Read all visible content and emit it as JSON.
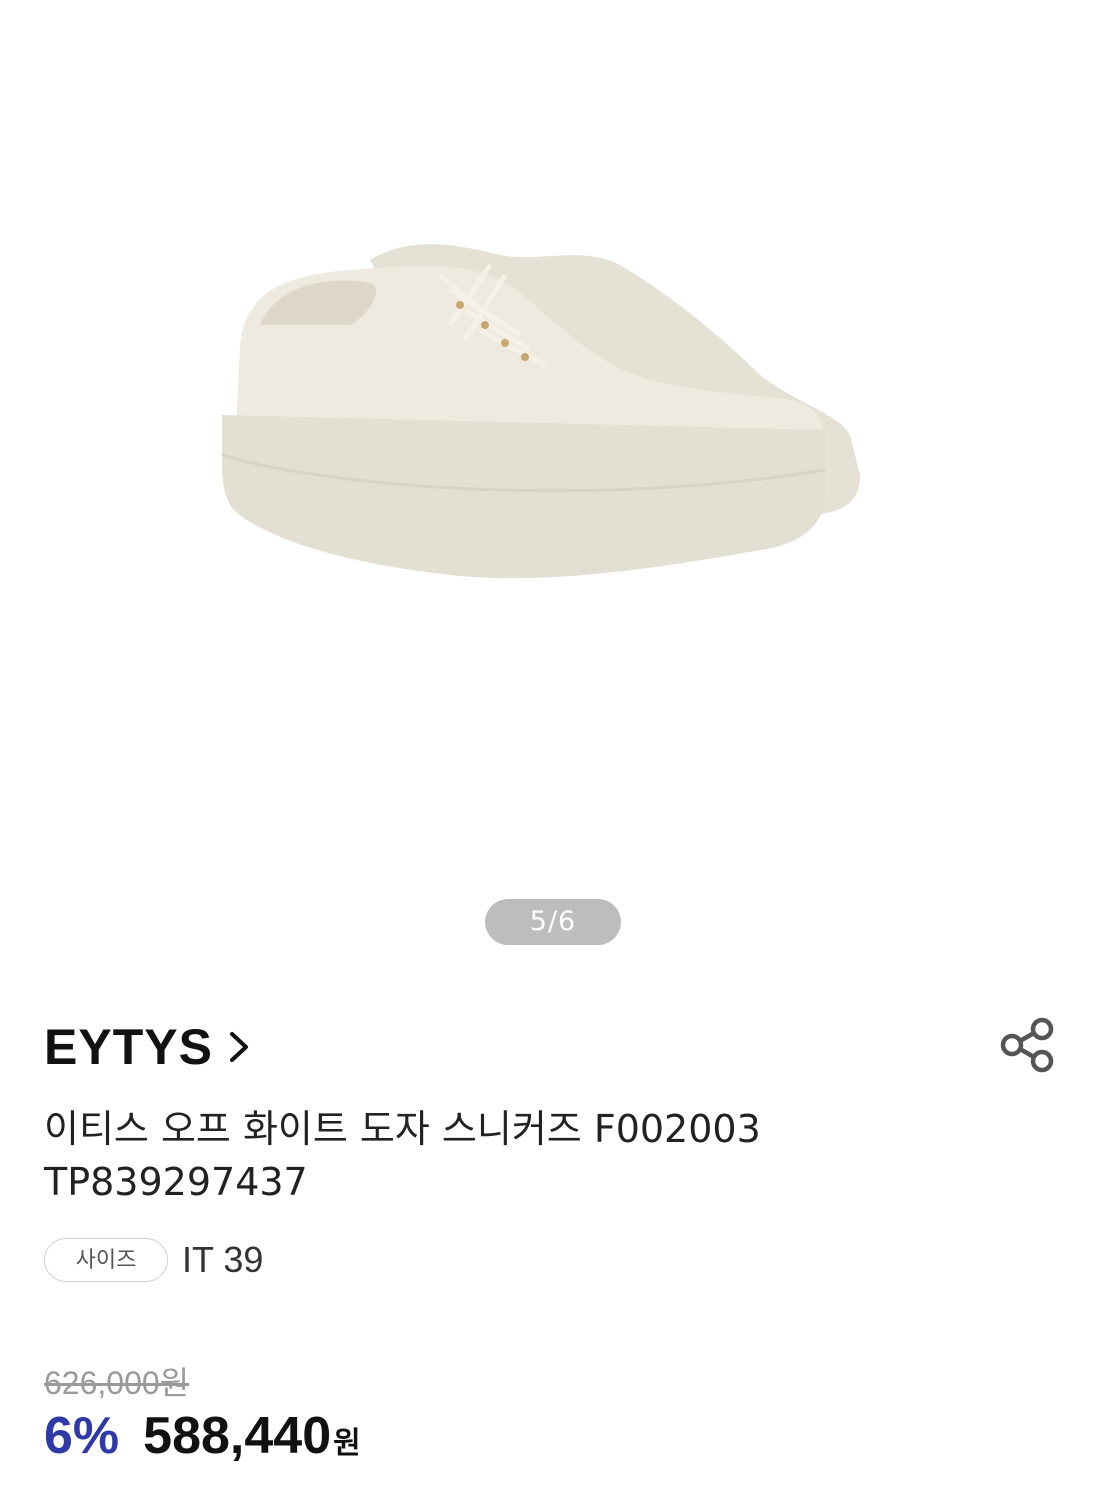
{
  "gallery": {
    "image_name": "sneaker-product-photo",
    "counter": "5/6"
  },
  "product": {
    "brand": "EYTYS",
    "title_line1": "이티스 오프 화이트 도자 스니커즈 F002003",
    "title_line2": "TP839297437",
    "size_label": "사이즈",
    "size_value": "IT 39"
  },
  "price": {
    "original": "626,000원",
    "discount": "6%",
    "sale": "588,440",
    "currency": "원"
  },
  "icons": {
    "brand_link": "chevron-right-icon",
    "share": "share-icon"
  },
  "colors": {
    "discount": "#2f3aa8",
    "counter_bg": "#bdbdbd",
    "shoe": "#ece8dc"
  }
}
